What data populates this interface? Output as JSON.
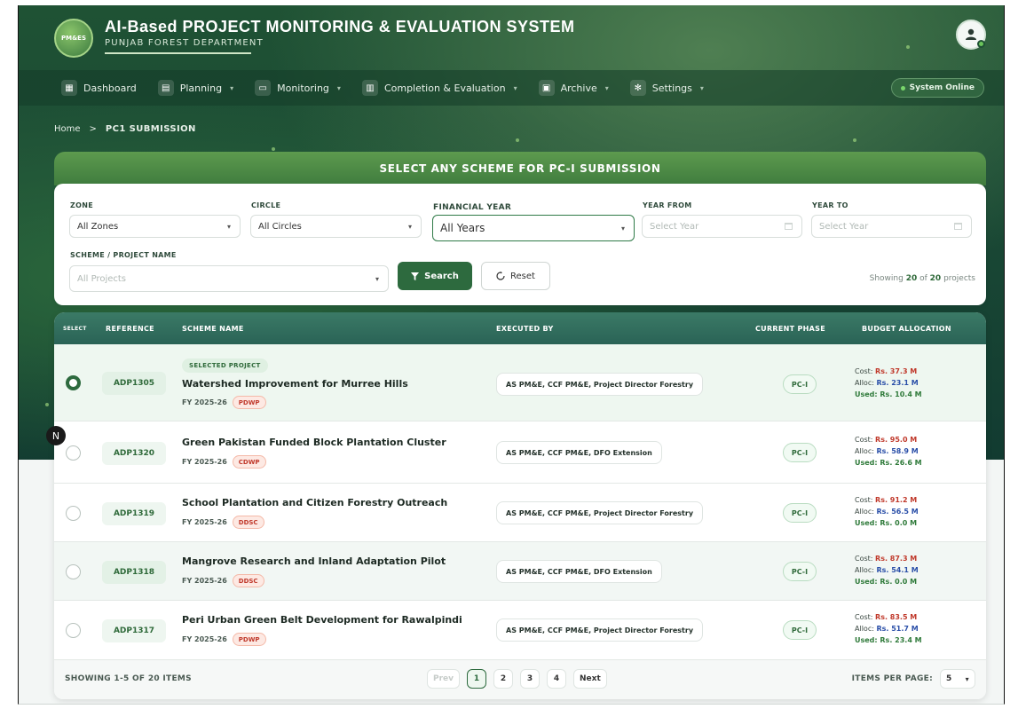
{
  "app": {
    "logo_text": "PM&ES",
    "title": "AI-Based PROJECT MONITORING & EVALUATION SYSTEM",
    "subtitle": "PUNJAB FOREST DEPARTMENT"
  },
  "nav": {
    "items": [
      {
        "label": "Dashboard",
        "icon": "grid-icon"
      },
      {
        "label": "Planning",
        "icon": "document-icon"
      },
      {
        "label": "Monitoring",
        "icon": "monitor-icon"
      },
      {
        "label": "Completion & Evaluation",
        "icon": "chart-icon"
      },
      {
        "label": "Archive",
        "icon": "archive-icon"
      },
      {
        "label": "Settings",
        "icon": "gear-icon"
      }
    ],
    "status": "System Online"
  },
  "breadcrumb": {
    "home": "Home",
    "separator": ">",
    "current": "PC1 SUBMISSION"
  },
  "banner": {
    "title": "SELECT ANY SCHEME FOR PC-I SUBMISSION"
  },
  "filters": {
    "zone": {
      "label": "ZONE",
      "value": "All Zones"
    },
    "circle": {
      "label": "CIRCLE",
      "value": "All Circles"
    },
    "financial_year": {
      "label": "FINANCIAL YEAR",
      "value": "All Years"
    },
    "year_from": {
      "label": "YEAR FROM",
      "placeholder": "Select Year"
    },
    "year_to": {
      "label": "YEAR TO",
      "placeholder": "Select Year"
    },
    "scheme": {
      "label": "SCHEME / PROJECT NAME",
      "placeholder": "All Projects"
    },
    "search_label": "Search",
    "reset_label": "Reset",
    "showing_prefix": "Showing",
    "showing_count": "20",
    "showing_of": "of",
    "showing_total": "20",
    "showing_suffix": "projects"
  },
  "table": {
    "headers": {
      "select": "SELECT",
      "reference": "REFERENCE",
      "scheme": "SCHEME NAME",
      "executed": "EXECUTED BY",
      "phase": "CURRENT PHASE",
      "budget": "BUDGET ALLOCATION"
    },
    "selected_badge": "SELECTED PROJECT",
    "rows": [
      {
        "ref": "ADP1305",
        "name": "Watershed Improvement for Murree Hills",
        "fy": "FY 2025-26",
        "tag": "PDWP",
        "executed": "AS PM&E, CCF PM&E, Project Director Forestry",
        "phase": "PC-I",
        "cost": "Rs. 37.3 M",
        "alloc": "Rs. 23.1 M",
        "used": "Used: Rs. 10.4 M",
        "selected": true
      },
      {
        "ref": "ADP1320",
        "name": "Green Pakistan Funded Block Plantation Cluster",
        "fy": "FY 2025-26",
        "tag": "CDWP",
        "executed": "AS PM&E, CCF PM&E, DFO Extension",
        "phase": "PC-I",
        "cost": "Rs. 95.0 M",
        "alloc": "Rs. 58.9 M",
        "used": "Used: Rs. 26.6 M",
        "selected": false
      },
      {
        "ref": "ADP1319",
        "name": "School Plantation and Citizen Forestry Outreach",
        "fy": "FY 2025-26",
        "tag": "DDSC",
        "executed": "AS PM&E, CCF PM&E, Project Director Forestry",
        "phase": "PC-I",
        "cost": "Rs. 91.2 M",
        "alloc": "Rs. 56.5 M",
        "used": "Used: Rs. 0.0 M",
        "selected": false
      },
      {
        "ref": "ADP1318",
        "name": "Mangrove Research and Inland Adaptation Pilot",
        "fy": "FY 2025-26",
        "tag": "DDSC",
        "executed": "AS PM&E, CCF PM&E, DFO Extension",
        "phase": "PC-I",
        "cost": "Rs. 87.3 M",
        "alloc": "Rs. 54.1 M",
        "used": "Used: Rs. 0.0 M",
        "selected": false
      },
      {
        "ref": "ADP1317",
        "name": "Peri Urban Green Belt Development for Rawalpindi",
        "fy": "FY 2025-26",
        "tag": "PDWP",
        "executed": "AS PM&E, CCF PM&E, Project Director Forestry",
        "phase": "PC-I",
        "cost": "Rs. 83.5 M",
        "alloc": "Rs. 51.7 M",
        "used": "Used: Rs. 23.4 M",
        "selected": false
      }
    ],
    "cost_label": "Cost:",
    "alloc_label": "Alloc:"
  },
  "pagination": {
    "showing": "SHOWING 1-5 OF 20 ITEMS",
    "prev": "Prev",
    "pages": [
      "1",
      "2",
      "3",
      "4"
    ],
    "current": "1",
    "next": "Next",
    "per_page_label": "ITEMS PER PAGE:",
    "per_page_value": "5"
  },
  "overlay": {
    "badge": "N"
  }
}
